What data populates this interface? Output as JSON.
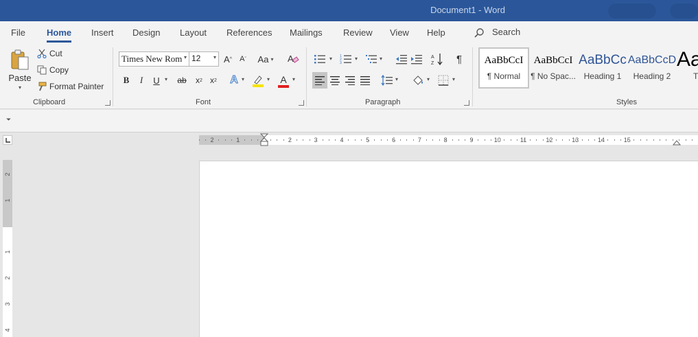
{
  "window": {
    "title": "Document1  -  Word"
  },
  "menu": {
    "tabs": [
      "File",
      "Home",
      "Insert",
      "Design",
      "Layout",
      "References",
      "Mailings",
      "Review",
      "View",
      "Help"
    ],
    "active": "Home",
    "search_label": "Search"
  },
  "clipboard": {
    "paste_label": "Paste",
    "cut_label": "Cut",
    "copy_label": "Copy",
    "format_painter_label": "Format Painter",
    "group_label": "Clipboard"
  },
  "font": {
    "family": "Times New Rom",
    "size": "12",
    "change_case_label": "Aa",
    "group_label": "Font",
    "highlight_color": "#f5e400",
    "font_color": "#e02020"
  },
  "paragraph": {
    "group_label": "Paragraph"
  },
  "styles": {
    "items": [
      {
        "sample": "AaBbCcI",
        "name": "¶ Normal"
      },
      {
        "sample": "AaBbCcI",
        "name": "¶ No Spac..."
      },
      {
        "sample": "AaBbCc",
        "name": "Heading 1"
      },
      {
        "sample": "AaBbCcD",
        "name": "Heading 2"
      },
      {
        "sample": "Aa",
        "name": "T"
      }
    ],
    "group_label": "Styles"
  },
  "ruler": {
    "horizontal_labels": [
      "2",
      "1",
      "1",
      "2",
      "3",
      "4",
      "5",
      "6",
      "7",
      "8",
      "9",
      "10",
      "11",
      "12",
      "13",
      "14",
      "15"
    ],
    "vertical_labels": [
      "2",
      "1",
      "1",
      "2",
      "3",
      "4"
    ]
  },
  "colors": {
    "accent": "#2b579a",
    "ribbon": "#f3f3f3",
    "canvas": "#e6e6e6"
  }
}
